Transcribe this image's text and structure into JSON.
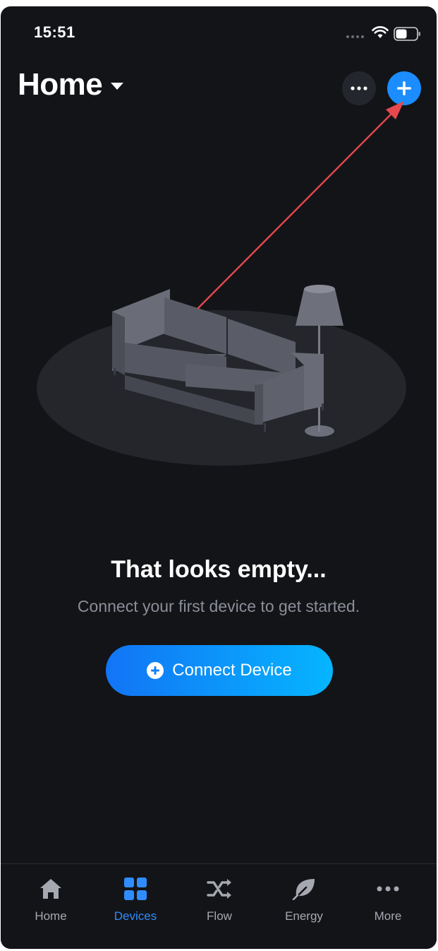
{
  "status_bar": {
    "time": "15:51"
  },
  "header": {
    "title": "Home"
  },
  "empty_state": {
    "title": "That looks empty...",
    "subtitle": "Connect your first device to get started.",
    "button_label": "Connect Device"
  },
  "tabs": [
    {
      "label": "Home",
      "icon": "home-icon",
      "active": false
    },
    {
      "label": "Devices",
      "icon": "grid-icon",
      "active": true
    },
    {
      "label": "Flow",
      "icon": "shuffle-icon",
      "active": false
    },
    {
      "label": "Energy",
      "icon": "leaf-icon",
      "active": false
    },
    {
      "label": "More",
      "icon": "more-dots-icon",
      "active": false
    }
  ],
  "colors": {
    "background": "#131418",
    "accent": "#1b8dff",
    "active_tab": "#2f8dff",
    "annotation_arrow": "#e5484d"
  }
}
